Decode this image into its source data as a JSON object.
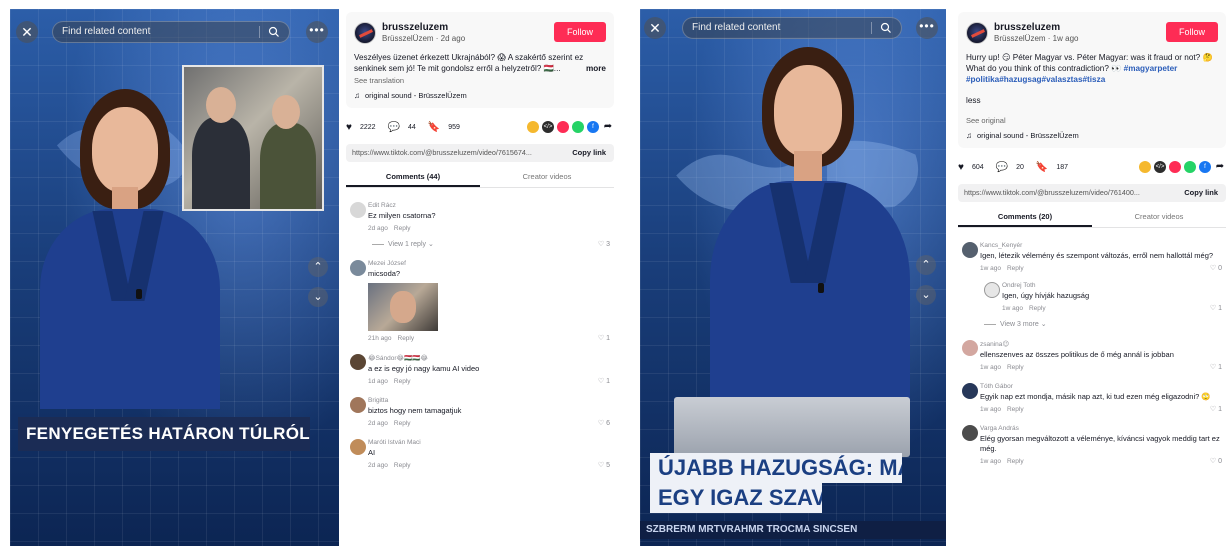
{
  "overlay": {
    "search_placeholder": "Find related content",
    "close_glyph": "✕",
    "more_glyph": "•••",
    "up_glyph": "⌃",
    "down_glyph": "⌄"
  },
  "left": {
    "video": {
      "headline": "FENYEGETÉS HATÁRON TÚLRÓL"
    },
    "post": {
      "author": "brusszeluzem",
      "author_sub": "BrüsszelÜzem · 2d ago",
      "follow": "Follow",
      "description": "Veszélyes üzenet érkezett Ukrajnából? 😱 A szakértő szerint ez senkinek sem jó! Te mit gondolsz erről a helyzetről? 🇭🇺...",
      "more": "more",
      "translate": "See translation",
      "sound": "original sound - BrüsszelÜzem",
      "likes": "2222",
      "comments_count": "44",
      "saves": "959",
      "link": "https://www.tiktok.com/@brusszeluzem/video/7615674...",
      "copy": "Copy link",
      "tab_comments": "Comments (44)",
      "tab_creator": "Creator videos"
    },
    "comments": [
      {
        "name": "Edit Rácz",
        "text": "Ez milyen csatorna?",
        "time": "2d ago",
        "reply": "Reply",
        "likes": "3",
        "view_replies": "View 1 reply"
      },
      {
        "name": "Mezei József",
        "text": "micsoda?",
        "time": "21h ago",
        "reply": "Reply",
        "likes": "1"
      },
      {
        "name": "😂Sándor😂🇭🇺🇭🇺😂",
        "text": "a ez is egy jó nagy kamu AI video",
        "time": "1d ago",
        "reply": "Reply",
        "likes": "1"
      },
      {
        "name": "Brigitta",
        "text": "biztos hogy nem tamagatjuk",
        "time": "2d ago",
        "reply": "Reply",
        "likes": "6"
      },
      {
        "name": "Maróti István Maci",
        "text": "AI",
        "time": "2d ago",
        "reply": "Reply",
        "likes": "5"
      }
    ]
  },
  "right": {
    "video": {
      "headline_line1": "ÚJABB HAZUGSÁG: MÁR",
      "headline_line2": "EGY IGAZ SZAV",
      "ticker": "SZBRERM MRTVRAHMR TROCMA SINCSEN"
    },
    "post": {
      "author": "brusszeluzem",
      "author_sub": "BrüsszelÜzem · 1w ago",
      "follow": "Follow",
      "description": "Hurry up! 😏 Péter Magyar vs. Péter Magyar: was it fraud or not? 🤔 What do you think of this contradiction? 👀",
      "tags": "#magyarpeter #politika#hazugsag#valasztas#tisza",
      "less": "less",
      "see_original": "See original",
      "sound": "original sound - BrüsszelÜzem",
      "likes": "604",
      "comments_count": "20",
      "saves": "187",
      "link": "https://www.tiktok.com/@brusszeluzem/video/761400...",
      "copy": "Copy link",
      "tab_comments": "Comments (20)",
      "tab_creator": "Creator videos"
    },
    "comments": [
      {
        "name": "Kancs_Kenyér",
        "text": "Igen, létezik vélemény és szempont változás, erről nem hallottál még?",
        "time": "1w ago",
        "reply": "Reply",
        "likes": "0"
      },
      {
        "name": "Ondrej Toth",
        "text": "Igen, úgy hívják hazugság",
        "time": "1w ago",
        "reply": "Reply",
        "likes": "1",
        "view_more": "View 3 more"
      },
      {
        "name": "zsanina😉",
        "text": "ellenszenves az összes politikus de ő még annál is jobban",
        "time": "1w ago",
        "reply": "Reply",
        "likes": "1"
      },
      {
        "name": "Tóth Gábor",
        "text": "Egyik nap ezt mondja, másik nap azt, ki tud ezen még eligazodni? 🙄",
        "time": "1w ago",
        "reply": "Reply",
        "likes": "1"
      },
      {
        "name": "Varga András",
        "text": "Elég gyorsan megváltozott a véleménye, kíváncsi vagyok meddig tart ez még.",
        "time": "1w ago",
        "reply": "Reply",
        "likes": "0"
      }
    ]
  },
  "icons": {
    "like": "heart-icon",
    "comment": "comment-icon",
    "save": "bookmark-icon",
    "share_colors": [
      "#f5b82e",
      "#2d2d2d",
      "#fe2c55",
      "#25d366",
      "#1877f2"
    ]
  }
}
